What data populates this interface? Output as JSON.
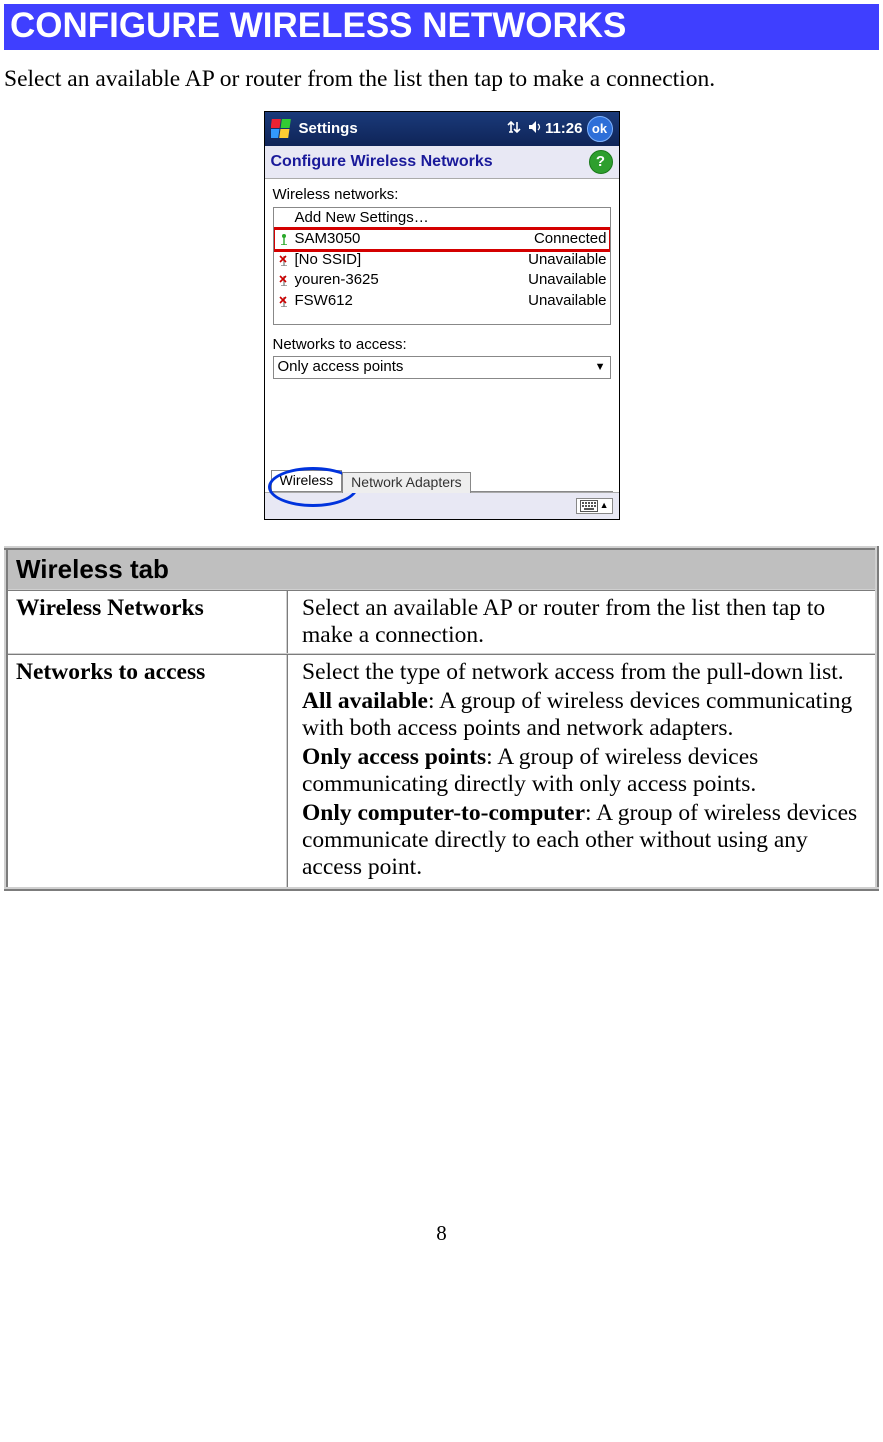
{
  "header": {
    "title": "CONFIGURE WIRELESS NETWORKS"
  },
  "intro": "Select an available AP or router from the list then tap to make a connection.",
  "pda": {
    "topbar": {
      "app": "Settings",
      "time": "11:26",
      "ok": "ok"
    },
    "subhead": "Configure Wireless Networks",
    "wireless_label": "Wireless networks:",
    "list": {
      "add": "Add New Settings…",
      "r1_name": "SAM3050",
      "r1_stat": "Connected",
      "r2_name": "[No SSID]",
      "r2_stat": "Unavailable",
      "r3_name": "youren-3625",
      "r3_stat": "Unavailable",
      "r4_name": "FSW612",
      "r4_stat": "Unavailable"
    },
    "access_label": "Networks to access:",
    "access_value": "Only access points",
    "tabs": {
      "t1": "Wireless",
      "t2": "Network Adapters"
    }
  },
  "table": {
    "head": "Wireless tab",
    "row1_l": "Wireless Networks",
    "row1_r": "Select an available AP or router from the list then tap to make a connection.",
    "row2_l": "Networks to access",
    "row2_r1": "Select the type of network access from the pull-down list.",
    "row2_b1": "All available",
    "row2_t1": ": A group of wireless devices communicating with both access points and network adapters.",
    "row2_b2": "Only access points",
    "row2_t2": ": A group of wireless devices communicating directly with only access points.",
    "row2_b3": "Only computer-to-computer",
    "row2_t3": ": A group of wireless devices communicate directly to each other without using any access point."
  },
  "page": "8"
}
